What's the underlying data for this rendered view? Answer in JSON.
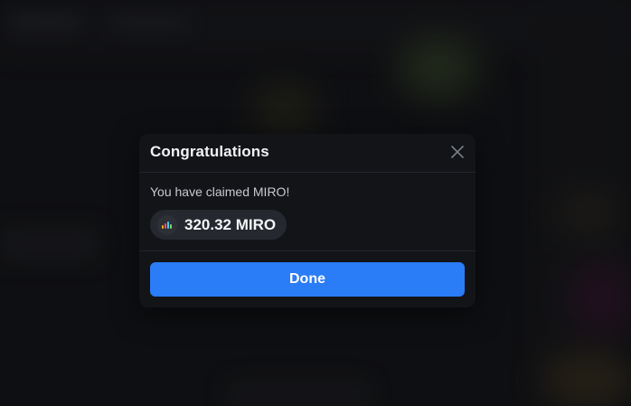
{
  "modal": {
    "title": "Congratulations",
    "close_icon": "close-icon",
    "message": "You have claimed MIRO!",
    "amount": "320.32 MIRO",
    "token_icon": "miro-token-icon",
    "done_label": "Done"
  },
  "colors": {
    "accent": "#2a7cf7",
    "modal_bg": "#121418",
    "pill_bg": "#25282e"
  }
}
